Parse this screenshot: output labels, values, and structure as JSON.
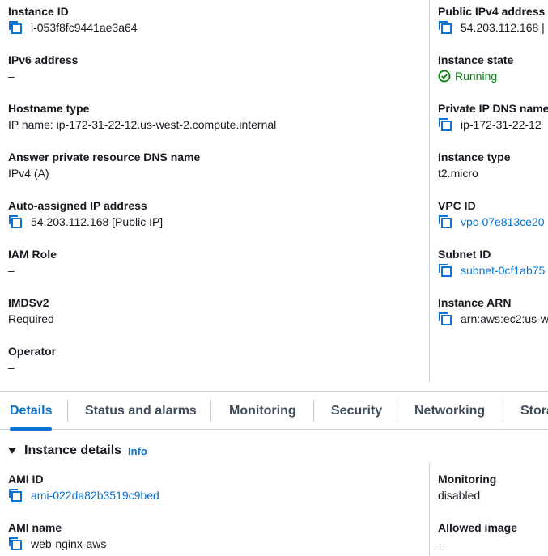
{
  "left_fields": [
    {
      "label": "Instance ID",
      "value": "i-053f8fc9441ae3a64"
    },
    {
      "label": "IPv6 address",
      "value": "–"
    },
    {
      "label": "Hostname type",
      "value": "IP name: ip-172-31-22-12.us-west-2.compute.internal"
    },
    {
      "label": "Answer private resource DNS name",
      "value": "IPv4 (A)"
    },
    {
      "label": "Auto-assigned IP address",
      "value": "54.203.112.168 [Public IP]"
    },
    {
      "label": "IAM Role",
      "value": "–"
    },
    {
      "label": "IMDSv2",
      "value": "Required"
    },
    {
      "label": "Operator",
      "value": "–"
    }
  ],
  "right_fields": [
    {
      "label": "Public IPv4 address",
      "value": "54.203.112.168 |"
    },
    {
      "label": "Instance state",
      "value": "Running"
    },
    {
      "label": "Private IP DNS name",
      "value": "ip-172-31-22-12"
    },
    {
      "label": "Instance type",
      "value": "t2.micro"
    },
    {
      "label": "VPC ID",
      "value": "vpc-07e813ce20"
    },
    {
      "label": "Subnet ID",
      "value": "subnet-0cf1ab75"
    },
    {
      "label": "Instance ARN",
      "value": "arn:aws:ec2:us-w"
    }
  ],
  "tabs": [
    "Details",
    "Status and alarms",
    "Monitoring",
    "Security",
    "Networking",
    "Stora"
  ],
  "section": {
    "title": "Instance details",
    "info": "Info"
  },
  "details_left": [
    {
      "label": "AMI ID",
      "value": "ami-022da82b3519c9bed"
    },
    {
      "label": "AMI name",
      "value": "web-nginx-aws"
    }
  ],
  "details_right": [
    {
      "label": "Monitoring",
      "value": "disabled"
    },
    {
      "label": "Allowed image",
      "value": "-"
    }
  ],
  "colors": {
    "link": "#0972d3",
    "success": "#037f0c",
    "text": "#16191f",
    "divider": "#d1d5db"
  }
}
